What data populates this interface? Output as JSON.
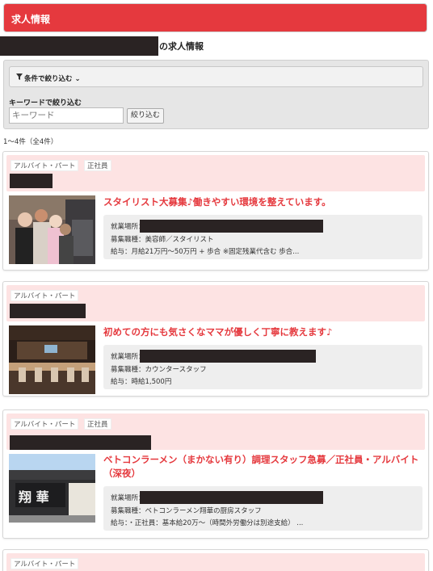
{
  "header": {
    "title": "求人情報"
  },
  "subtitle": "の求人情報",
  "filter": {
    "condition_label": "条件で絞り込む",
    "condition_icon": "filter-icon",
    "keyword_label": "キーワードで絞り込む",
    "keyword_placeholder": "キーワード",
    "keyword_value": "",
    "submit_label": "絞り込む"
  },
  "result_count": "1～4件（全4件）",
  "jobs": [
    {
      "tags": [
        "アルバイト・パート",
        "正社員"
      ],
      "headline": "スタイリスト大募集♪働きやすい環境を整えています。",
      "location_label": "就業場所：",
      "role": "募集職種：美容師／スタイリスト",
      "salary": "給与：月給21万円～50万円 + 歩合 ※固定残業代含む 歩合..."
    },
    {
      "tags": [
        "アルバイト・パート"
      ],
      "headline": "初めての方にも気さくなママが優しく丁寧に教えます♪",
      "location_label": "就業場所：",
      "role": "募集職種：カウンタースタッフ",
      "salary": "給与：時給1,500円"
    },
    {
      "tags": [
        "アルバイト・パート",
        "正社員"
      ],
      "headline_line1": "ベトコンラーメン（まかない有り）調理スタッフ急募／正社員・アルバイト",
      "headline_line2": "（深夜）",
      "location_label": "就業場所：",
      "role": "募集職種：ベトコンラーメン翔華の厨房スタッフ",
      "salary": "給与：・正社員：基本給20万～（時間外労働分は別途支給） ..."
    },
    {
      "tags": [
        "アルバイト・パート"
      ]
    }
  ]
}
